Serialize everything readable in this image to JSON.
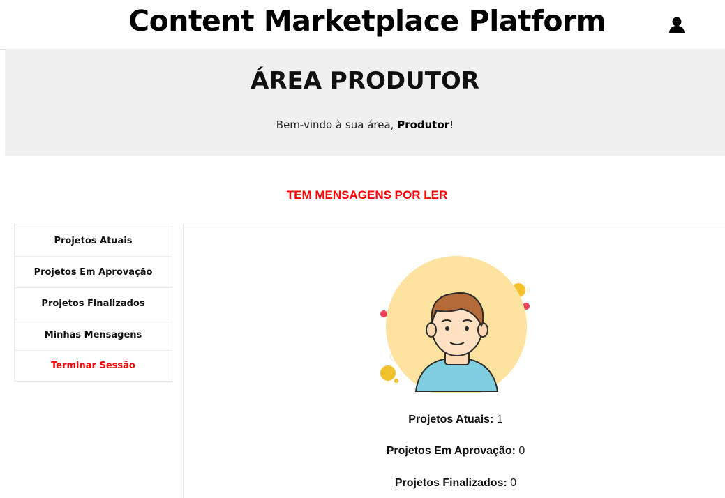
{
  "header": {
    "title": "Content Marketplace Platform",
    "user_icon": "user-icon"
  },
  "banner": {
    "title": "ÁREA PRODUTOR",
    "welcome_prefix": "Bem-vindo à sua área, ",
    "welcome_name": "Produtor",
    "welcome_suffix": "!"
  },
  "alert": {
    "text": "TEM MENSAGENS POR LER",
    "color": "#ff0000"
  },
  "sidebar": {
    "items": [
      {
        "label": "Projetos Atuais"
      },
      {
        "label": "Projetos Em Aprovação"
      },
      {
        "label": "Projetos Finalizados"
      },
      {
        "label": "Minhas Mensagens"
      },
      {
        "label": "Terminar Sessão"
      }
    ]
  },
  "profile": {
    "avatar_icon": "male-avatar-illustration",
    "stats": [
      {
        "label": "Projetos Atuais:",
        "value": "1"
      },
      {
        "label": "Projetos Em Aprovação:",
        "value": "0"
      },
      {
        "label": "Projetos Finalizados:",
        "value": "0"
      }
    ]
  }
}
